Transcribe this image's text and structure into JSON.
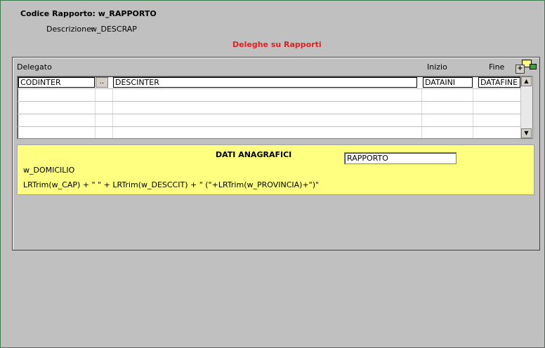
{
  "header": {
    "code_label": "Codice Rapporto: w_RAPPORTO",
    "desc_label": "Descrizione:",
    "desc_value": "w_DESCRAP"
  },
  "section": {
    "title": "Deleghe su Rapporti"
  },
  "grid": {
    "columns": {
      "delegato": "Delegato",
      "inizio": "Inizio",
      "fine": "Fine"
    },
    "first_row": {
      "codinter": "CODINTER",
      "dots": "..",
      "descinter": "DESCINTER",
      "dataini": "DATAINI",
      "datafine": "DATAFINE"
    },
    "scroll_up": "▲",
    "scroll_down": "▼"
  },
  "anagrafica": {
    "title": "DATI ANAGRAFICI",
    "rapporto_field": "RAPPORTO",
    "domicilio": "w_DOMICILIO",
    "address_expr": "LRTrim(w_CAP) + \" \" + LRTrim(w_DESCCIT) + \" (\"+LRTrim(w_PROVINCIA)+\")\""
  },
  "colors": {
    "section_title": "#e02020",
    "info_panel": "#ffff80",
    "background": "#c0c0c0"
  }
}
